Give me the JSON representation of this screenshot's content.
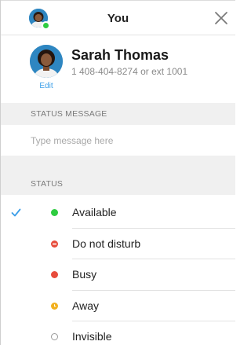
{
  "header": {
    "title": "You",
    "presence_color": "#2ecc40"
  },
  "profile": {
    "name": "Sarah Thomas",
    "phone": "1 408-404-8274 or ext 1001",
    "edit_label": "Edit"
  },
  "status_message": {
    "section_label": "STATUS MESSAGE",
    "placeholder": "Type message here",
    "value": ""
  },
  "status": {
    "section_label": "STATUS",
    "selected": "Available",
    "options": [
      {
        "label": "Available",
        "icon": "green-dot-icon",
        "color": "#2ecc40",
        "selected": true
      },
      {
        "label": "Do not disturb",
        "icon": "dnd-minus-icon",
        "color": "#e74c3c",
        "selected": false
      },
      {
        "label": "Busy",
        "icon": "red-dot-icon",
        "color": "#e74c3c",
        "selected": false
      },
      {
        "label": "Away",
        "icon": "clock-dot-icon",
        "color": "#f2b01e",
        "selected": false
      },
      {
        "label": "Invisible",
        "icon": "hollow-circle-icon",
        "color": "#9a9a9a",
        "selected": false
      }
    ]
  },
  "colors": {
    "accent": "#3b9ee8",
    "section_bg": "#f0f0f0"
  }
}
